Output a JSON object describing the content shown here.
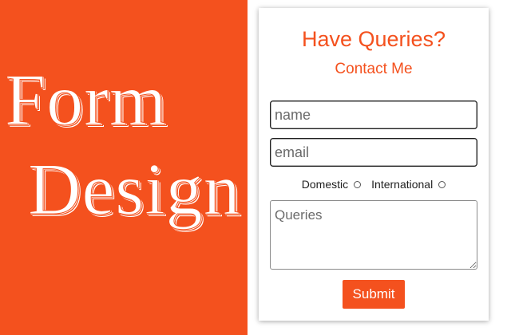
{
  "hero": {
    "line1": "Form",
    "line2": "Design"
  },
  "form": {
    "title": "Have Queries?",
    "subtitle": "Contact Me",
    "name_placeholder": "name",
    "email_placeholder": "email",
    "radio_options": [
      "Domestic",
      "International"
    ],
    "queries_placeholder": "Queries",
    "submit_label": "Submit"
  },
  "colors": {
    "accent": "#f4511e",
    "background": "#ffffff",
    "text": "#222222"
  }
}
